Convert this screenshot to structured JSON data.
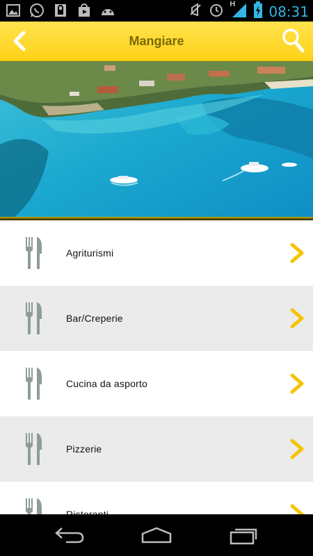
{
  "status_bar": {
    "time": "08:31",
    "network": "H",
    "left_icons": [
      "image-icon",
      "whatsapp-icon",
      "lock-icon",
      "play-store-icon",
      "android-icon"
    ],
    "right_icons": [
      "mute-icon",
      "alarm-icon",
      "signal-icon",
      "battery-icon"
    ]
  },
  "header": {
    "title": "Mangiare",
    "accent_color": "#ffd21a",
    "title_color": "#7a6a00"
  },
  "list": {
    "items": [
      {
        "label": "Agriturismi",
        "icon": "fork-knife-icon"
      },
      {
        "label": "Bar/Creperie",
        "icon": "fork-knife-icon"
      },
      {
        "label": "Cucina da asporto",
        "icon": "fork-knife-icon"
      },
      {
        "label": "Pizzerie",
        "icon": "fork-knife-icon"
      },
      {
        "label": "Ristoranti",
        "icon": "fork-knife-icon"
      }
    ],
    "chevron_color": "#f5c400",
    "icon_color": "#8d9b9b"
  }
}
